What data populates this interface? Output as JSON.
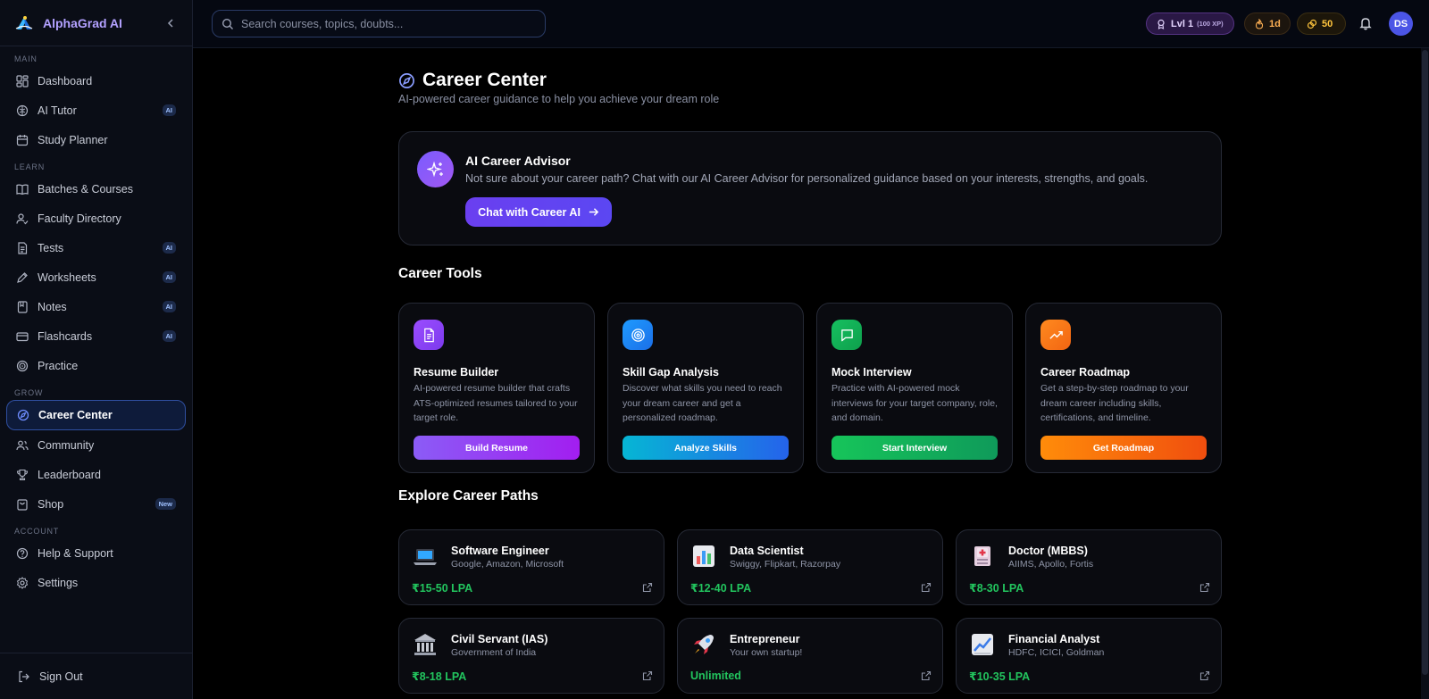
{
  "brand": {
    "name": "AlphaGrad AI"
  },
  "sidebar": {
    "sections": {
      "main": "MAIN",
      "learn": "LEARN",
      "grow": "GROW",
      "account": "ACCOUNT"
    },
    "items": {
      "dashboard": {
        "label": "Dashboard",
        "icon": "dashboard-icon"
      },
      "ai_tutor": {
        "label": "AI Tutor",
        "badge": "AI",
        "icon": "brain-icon"
      },
      "study_planner": {
        "label": "Study Planner",
        "icon": "calendar-icon"
      },
      "batches": {
        "label": "Batches & Courses",
        "icon": "book-icon"
      },
      "faculty": {
        "label": "Faculty Directory",
        "icon": "user-check-icon"
      },
      "tests": {
        "label": "Tests",
        "badge": "AI",
        "icon": "file-icon"
      },
      "worksheets": {
        "label": "Worksheets",
        "badge": "AI",
        "icon": "pen-icon"
      },
      "notes": {
        "label": "Notes",
        "badge": "AI",
        "icon": "notebook-icon"
      },
      "flashcards": {
        "label": "Flashcards",
        "badge": "AI",
        "icon": "cards-icon"
      },
      "practice": {
        "label": "Practice",
        "icon": "target-icon"
      },
      "career_center": {
        "label": "Career Center",
        "icon": "compass-icon",
        "active": true
      },
      "community": {
        "label": "Community",
        "icon": "users-icon"
      },
      "leaderboard": {
        "label": "Leaderboard",
        "icon": "trophy-icon"
      },
      "shop": {
        "label": "Shop",
        "badge": "New",
        "icon": "bag-icon"
      },
      "help": {
        "label": "Help & Support",
        "icon": "help-icon"
      },
      "settings": {
        "label": "Settings",
        "icon": "gear-icon"
      }
    },
    "sign_out": "Sign Out"
  },
  "topbar": {
    "search_placeholder": "Search courses, topics, doubts...",
    "level": "Lvl 1",
    "xp": "(100 XP)",
    "streak": "1d",
    "coins": "50",
    "avatar_initials": "DS"
  },
  "page": {
    "title": "Career Center",
    "subtitle": "AI-powered career guidance to help you achieve your dream role"
  },
  "advisor": {
    "title": "AI Career Advisor",
    "description": "Not sure about your career path? Chat with our AI Career Advisor for personalized guidance based on your interests, strengths, and goals.",
    "cta": "Chat with Career AI"
  },
  "career_tools": {
    "heading": "Career Tools",
    "items": [
      {
        "title": "Resume Builder",
        "description": "AI-powered resume builder that crafts ATS-optimized resumes tailored to your target role.",
        "button": "Build Resume",
        "icon": "document-icon",
        "color": "#8b3cf0"
      },
      {
        "title": "Skill Gap Analysis",
        "description": "Discover what skills you need to reach your dream career and get a personalized roadmap.",
        "button": "Analyze Skills",
        "icon": "target-icon",
        "color": "#1c7ff0"
      },
      {
        "title": "Mock Interview",
        "description": "Practice with AI-powered mock interviews for your target company, role, and domain.",
        "button": "Start Interview",
        "icon": "chat-icon",
        "color": "#12b556"
      },
      {
        "title": "Career Roadmap",
        "description": "Get a step-by-step roadmap to your dream career including skills, certifications, and timeline.",
        "button": "Get Roadmap",
        "icon": "trending-up-icon",
        "color": "#f97316"
      }
    ]
  },
  "career_paths": {
    "heading": "Explore Career Paths",
    "items": [
      {
        "title": "Software Engineer",
        "companies": "Google, Amazon, Microsoft",
        "salary": "₹15-50 LPA",
        "icon": "laptop-icon"
      },
      {
        "title": "Data Scientist",
        "companies": "Swiggy, Flipkart, Razorpay",
        "salary": "₹12-40 LPA",
        "icon": "bar-chart-icon"
      },
      {
        "title": "Doctor (MBBS)",
        "companies": "AIIMS, Apollo, Fortis",
        "salary": "₹8-30 LPA",
        "icon": "hospital-icon"
      },
      {
        "title": "Civil Servant (IAS)",
        "companies": "Government of India",
        "salary": "₹8-18 LPA",
        "icon": "classical-building-icon"
      },
      {
        "title": "Entrepreneur",
        "companies": "Your own startup!",
        "salary": "Unlimited",
        "icon": "rocket-icon"
      },
      {
        "title": "Financial Analyst",
        "companies": "HDFC, ICICI, Goldman",
        "salary": "₹10-35 LPA",
        "icon": "chart-up-icon"
      }
    ]
  }
}
